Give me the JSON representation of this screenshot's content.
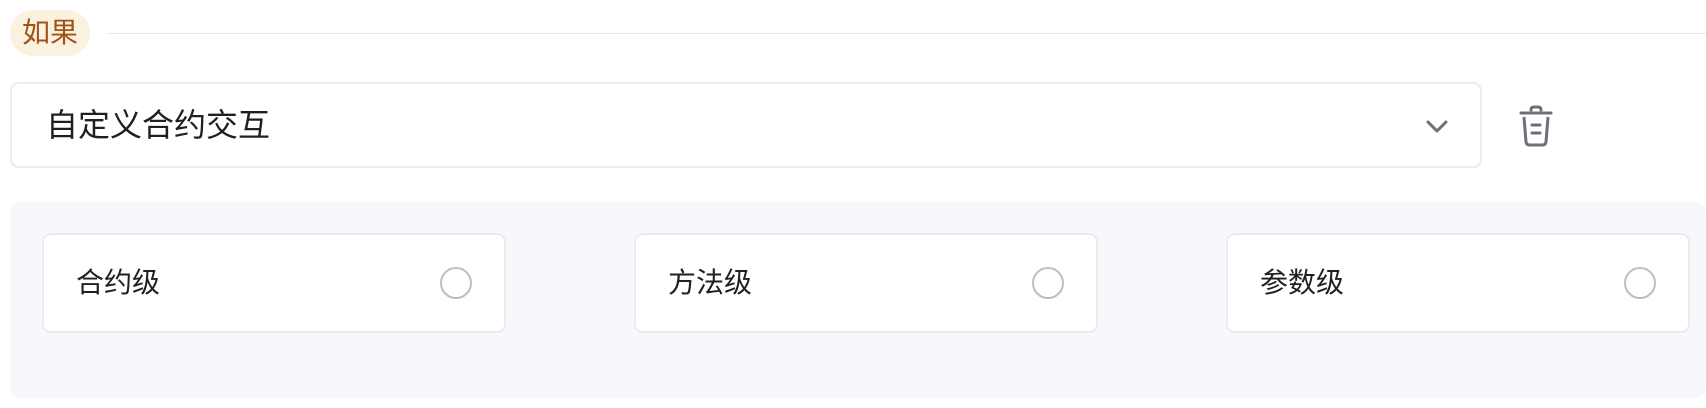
{
  "condition": {
    "tag_label": "如果"
  },
  "select": {
    "value": "自定义合约交互",
    "chevron_icon": "chevron-down-icon"
  },
  "actions": {
    "delete_icon": "trash-icon"
  },
  "options": [
    {
      "label": "合约级",
      "selected": false
    },
    {
      "label": "方法级",
      "selected": false
    },
    {
      "label": "参数级",
      "selected": false
    }
  ],
  "colors": {
    "tag_bg": "#fbf1df",
    "tag_text": "#a0521a",
    "panel_bg": "#f7f8fb",
    "border": "#ececef",
    "icon": "#6f6f7a"
  }
}
